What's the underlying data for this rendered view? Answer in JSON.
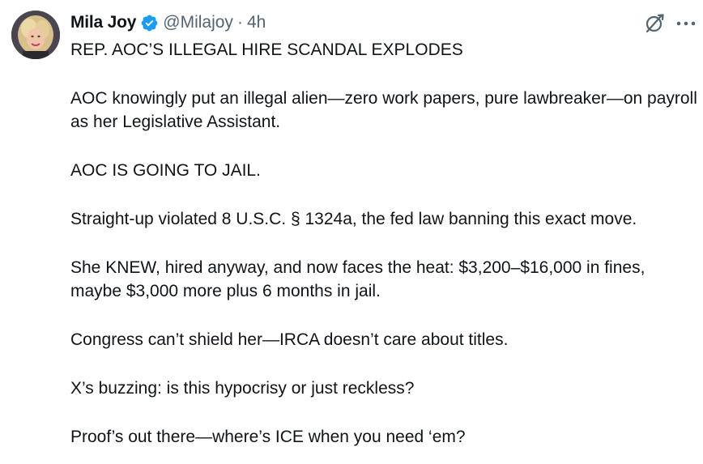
{
  "author": {
    "display_name": "Mila Joy",
    "handle": "@Milajoy",
    "separator": "·",
    "time": "4h"
  },
  "icons": {
    "verified": "verified-badge-icon",
    "grok": "grok-icon",
    "more": "more-options-icon"
  },
  "colors": {
    "verified_blue": "#1d9bf0",
    "text_primary": "#0f1419",
    "text_secondary": "#536471"
  },
  "tweet": {
    "paragraphs": [
      "REP. AOC’S ILLEGAL HIRE SCANDAL EXPLODES",
      "AOC knowingly put an illegal alien—zero work papers, pure lawbreaker—on payroll as her Legislative Assistant.",
      "AOC IS GOING TO JAIL.",
      "Straight-up violated 8 U.S.C. § 1324a, the fed law banning this exact move.",
      "She KNEW, hired anyway, and now faces the heat: $3,200–$16,000 in fines, maybe $3,000 more plus 6 months in jail.",
      "Congress can’t shield her—IRCA doesn’t care about titles.",
      "X’s buzzing: is this hypocrisy or just reckless?",
      "Proof’s out there—where’s ICE when you need ‘em?"
    ]
  }
}
